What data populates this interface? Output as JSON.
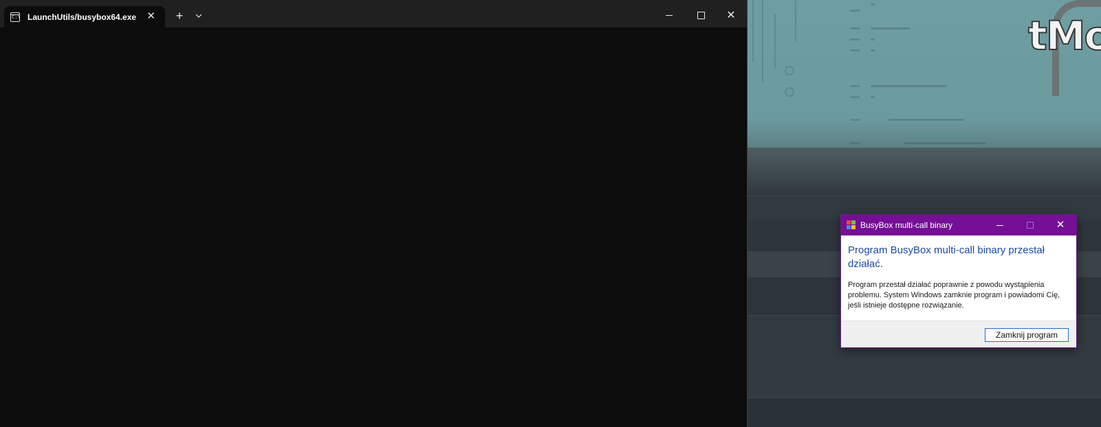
{
  "terminal": {
    "tab_title": "LaunchUtils/busybox64.exe",
    "tab_icon": "terminal-icon",
    "tab_icon_text": "C:\\",
    "new_tab_label": "+",
    "dropdown_label": "⌄",
    "close_tab_label": "✕",
    "close_window_label": "✕",
    "background_color": "#0c0c0c",
    "titlebar_color": "#202020"
  },
  "wallpaper": {
    "logo_text": "tMo"
  },
  "dialog": {
    "title": "BusyBox multi-call binary",
    "heading": "Program BusyBox multi-call binary przestał działać.",
    "message": "Program przestał działać poprawnie z powodu wystąpienia problemu. System Windows zamknie program i powiadomi Cię, jeśli istnieje dostępne rozwiązanie.",
    "close_program_label": "Zamknij program",
    "close_label": "✕",
    "titlebar_color": "#750f96",
    "heading_color": "#1a4aa8"
  }
}
